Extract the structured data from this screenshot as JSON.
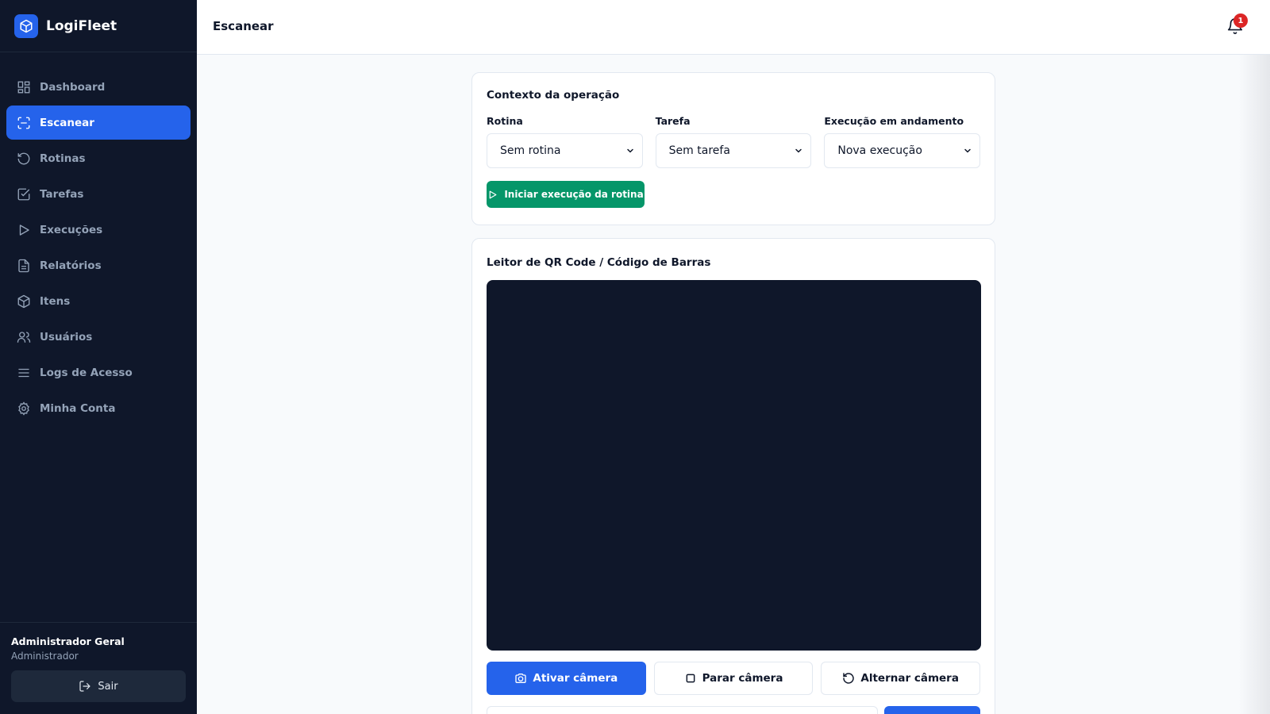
{
  "app": {
    "name": "LogiFleet"
  },
  "sidebar": {
    "items": [
      {
        "label": "Dashboard",
        "icon": "dashboard-icon",
        "active": false
      },
      {
        "label": "Escanear",
        "icon": "scan-icon",
        "active": true
      },
      {
        "label": "Rotinas",
        "icon": "routines-icon",
        "active": false
      },
      {
        "label": "Tarefas",
        "icon": "tasks-icon",
        "active": false
      },
      {
        "label": "Execuções",
        "icon": "play-icon",
        "active": false
      },
      {
        "label": "Relatórios",
        "icon": "reports-icon",
        "active": false
      },
      {
        "label": "Itens",
        "icon": "box-icon",
        "active": false
      },
      {
        "label": "Usuários",
        "icon": "users-icon",
        "active": false
      },
      {
        "label": "Logs de Acesso",
        "icon": "list-icon",
        "active": false
      },
      {
        "label": "Minha Conta",
        "icon": "gear-icon",
        "active": false
      }
    ],
    "user": {
      "name": "Administrador Geral",
      "role": "Administrador"
    },
    "logout_label": "Sair"
  },
  "header": {
    "title": "Escanear",
    "notification_count": "1"
  },
  "context": {
    "title": "Contexto da operação",
    "routine": {
      "label": "Rotina",
      "value": "Sem rotina"
    },
    "task": {
      "label": "Tarefa",
      "value": "Sem tarefa"
    },
    "execution": {
      "label": "Execução em andamento",
      "value": "Nova execução"
    },
    "start_label": "Iniciar execução da rotina"
  },
  "reader": {
    "title": "Leitor de QR Code / Código de Barras",
    "activate_label": "Ativar câmera",
    "stop_label": "Parar câmera",
    "switch_label": "Alternar câmera"
  },
  "colors": {
    "sidebar_bg": "#0f172a",
    "accent": "#2563eb",
    "success": "#059669",
    "danger": "#dc2626"
  }
}
